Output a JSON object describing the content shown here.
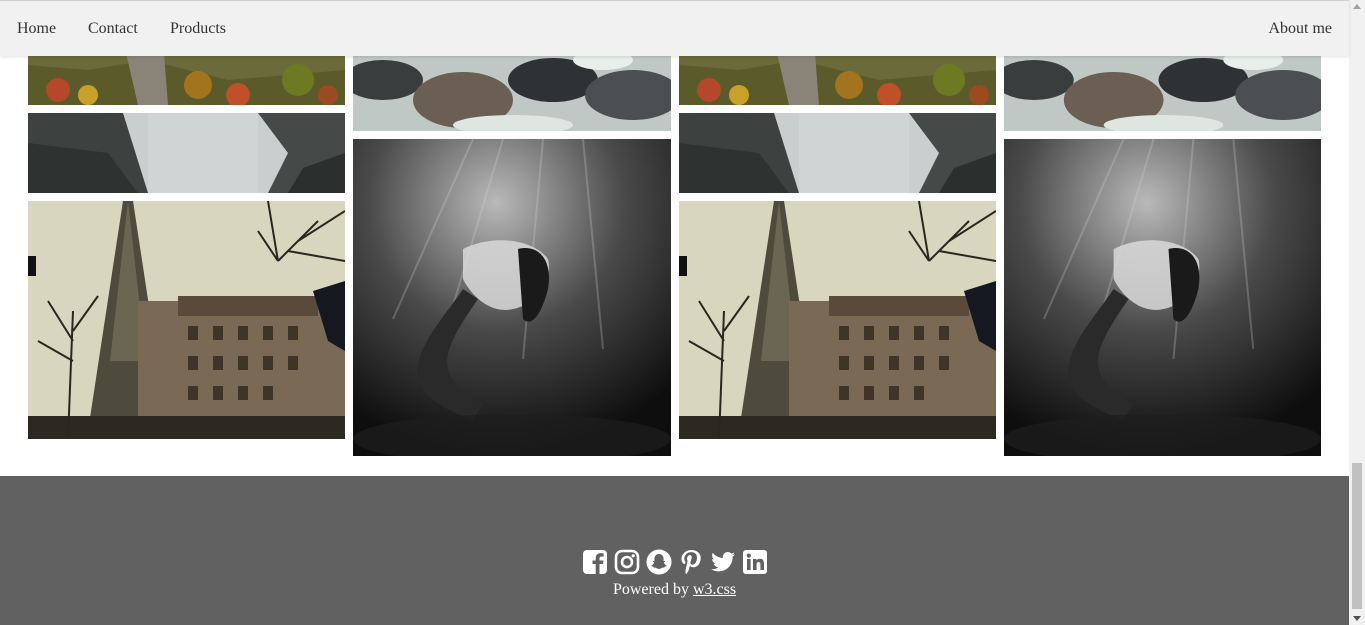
{
  "nav": {
    "home": "Home",
    "contact": "Contact",
    "products": "Products",
    "about": "About me"
  },
  "footer": {
    "powered_prefix": "Powered by ",
    "powered_link": "w3.css",
    "social_icons": [
      "facebook-icon",
      "instagram-icon",
      "snapchat-icon",
      "pinterest-icon",
      "twitter-icon",
      "linkedin-icon"
    ]
  },
  "colors": {
    "topbar": "#f1f1f1",
    "footer": "#616161",
    "footer_text": "#ffffff"
  }
}
